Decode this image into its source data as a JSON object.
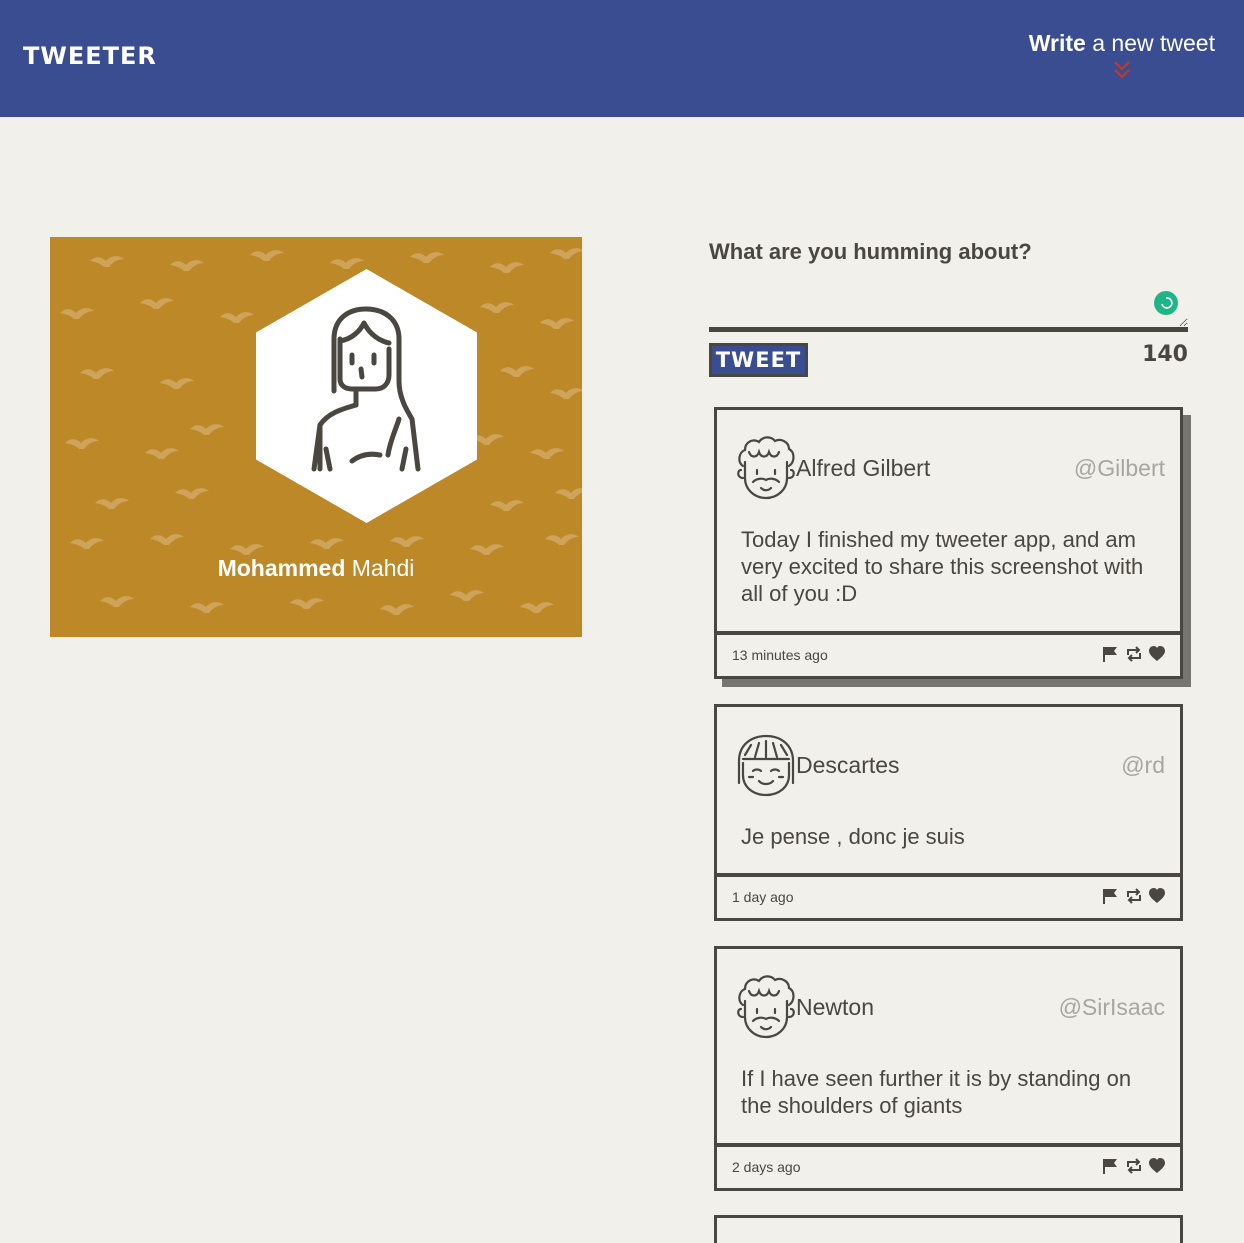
{
  "header": {
    "logo": "TWEETER",
    "write_bold": "Write",
    "write_rest": " a new tweet"
  },
  "profile": {
    "first_name": "Mohammed",
    "last_name": "Mahdi"
  },
  "compose": {
    "label": "What are you humming about?",
    "textarea_value": "",
    "tweet_button": "TWEET",
    "char_counter": "140"
  },
  "tweets": [
    {
      "name": "Alfred Gilbert",
      "handle": "@Gilbert",
      "text": "Today I finished my tweeter app, and am very excited to share this screenshot with all of you :D",
      "time": "13 minutes ago",
      "avatar": "curly-hair-avatar-icon"
    },
    {
      "name": "Descartes",
      "handle": "@rd",
      "text": "Je pense , donc je suis",
      "time": "1 day ago",
      "avatar": "bangs-hair-avatar-icon"
    },
    {
      "name": "Newton",
      "handle": "@SirIsaac",
      "text": "If I have seen further it is by standing on the shoulders of giants",
      "time": "2 days ago",
      "avatar": "curly-hair-avatar-icon"
    }
  ],
  "colors": {
    "header_bg": "#3a4d90",
    "profile_bg": "#bd8928",
    "page_bg": "#f2f0ea",
    "text": "#4a4640",
    "grammar_dot": "#1fb589",
    "chevron": "#c0392b"
  }
}
